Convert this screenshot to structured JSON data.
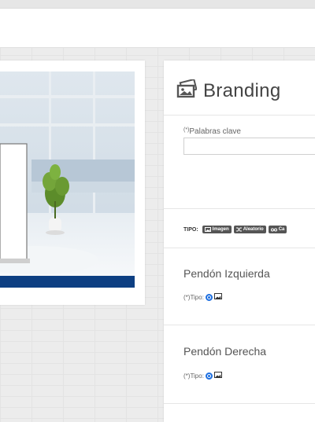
{
  "branding": {
    "title": "Branding",
    "keywords": {
      "label_req": "(*)",
      "label": "Palabras clave",
      "value": ""
    },
    "tipo": {
      "label": "TIPO:",
      "buttons": [
        {
          "icon": "image-icon",
          "label": "Imagen"
        },
        {
          "icon": "shuffle-icon",
          "label": "Aleatorio"
        },
        {
          "icon": "infinity-icon",
          "label": "Ca"
        }
      ]
    },
    "sections": [
      {
        "title": "Pendón Izquierda",
        "tipo_label": "(*)Tipo:"
      },
      {
        "title": "Pendón Derecha",
        "tipo_label": "(*)Tipo:"
      }
    ]
  },
  "colors": {
    "accent": "#1e6fe0",
    "dark_button": "#555555",
    "banner_blue": "#0d3f82"
  }
}
